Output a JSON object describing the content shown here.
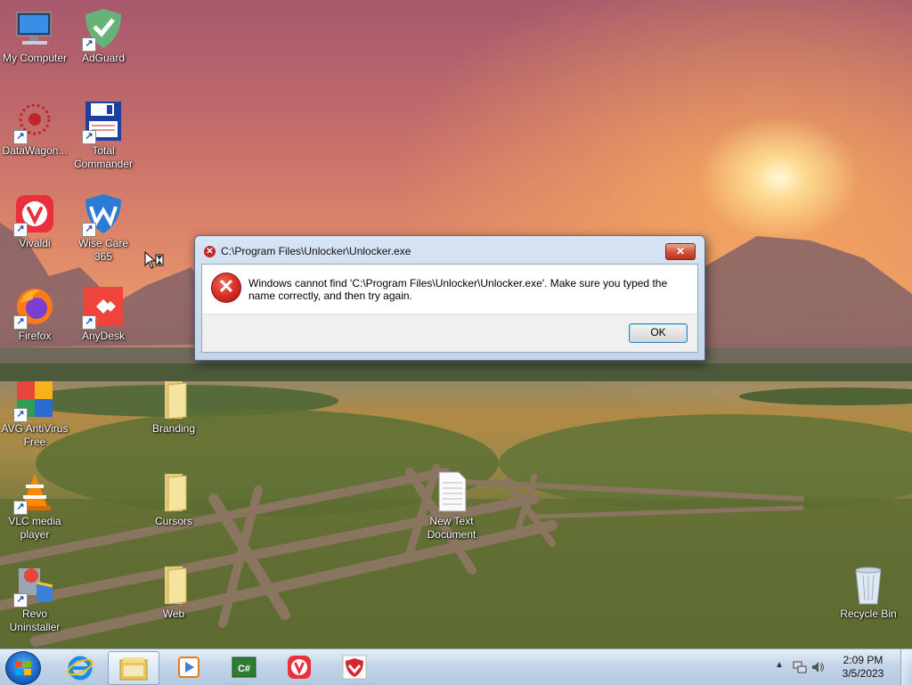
{
  "desktop_icons": [
    {
      "label": "My Computer"
    },
    {
      "label": "AdGuard"
    },
    {
      "label": "DataWagon..."
    },
    {
      "label": "Total Commander"
    },
    {
      "label": "Vivaldi"
    },
    {
      "label": "Wise Care 365"
    },
    {
      "label": "Firefox"
    },
    {
      "label": "AnyDesk"
    },
    {
      "label": "AVG AntiVirus Free"
    },
    {
      "label": "Branding"
    },
    {
      "label": "VLC media player"
    },
    {
      "label": "Cursors"
    },
    {
      "label": "New Text Document"
    },
    {
      "label": "Revo Uninstaller"
    },
    {
      "label": "Web"
    },
    {
      "label": "Recycle Bin"
    }
  ],
  "dialog": {
    "title": "C:\\Program Files\\Unlocker\\Unlocker.exe",
    "message": "Windows cannot find 'C:\\Program Files\\Unlocker\\Unlocker.exe'. Make sure you typed the name correctly, and then try again.",
    "ok_label": "OK",
    "close_glyph": "✕"
  },
  "taskbar": {
    "items": [
      {
        "icon": "internet-explorer-icon"
      },
      {
        "icon": "file-explorer-icon"
      },
      {
        "icon": "media-player-icon"
      },
      {
        "icon": "csharp-editor-icon"
      },
      {
        "icon": "vivaldi-icon"
      },
      {
        "icon": "adguard-icon"
      }
    ],
    "time": "2:09 PM",
    "date": "3/5/2023"
  },
  "colors": {
    "error_red": "#d32a20",
    "taskbar": "#c4d5e8",
    "ok_border": "#3c7fb1"
  }
}
